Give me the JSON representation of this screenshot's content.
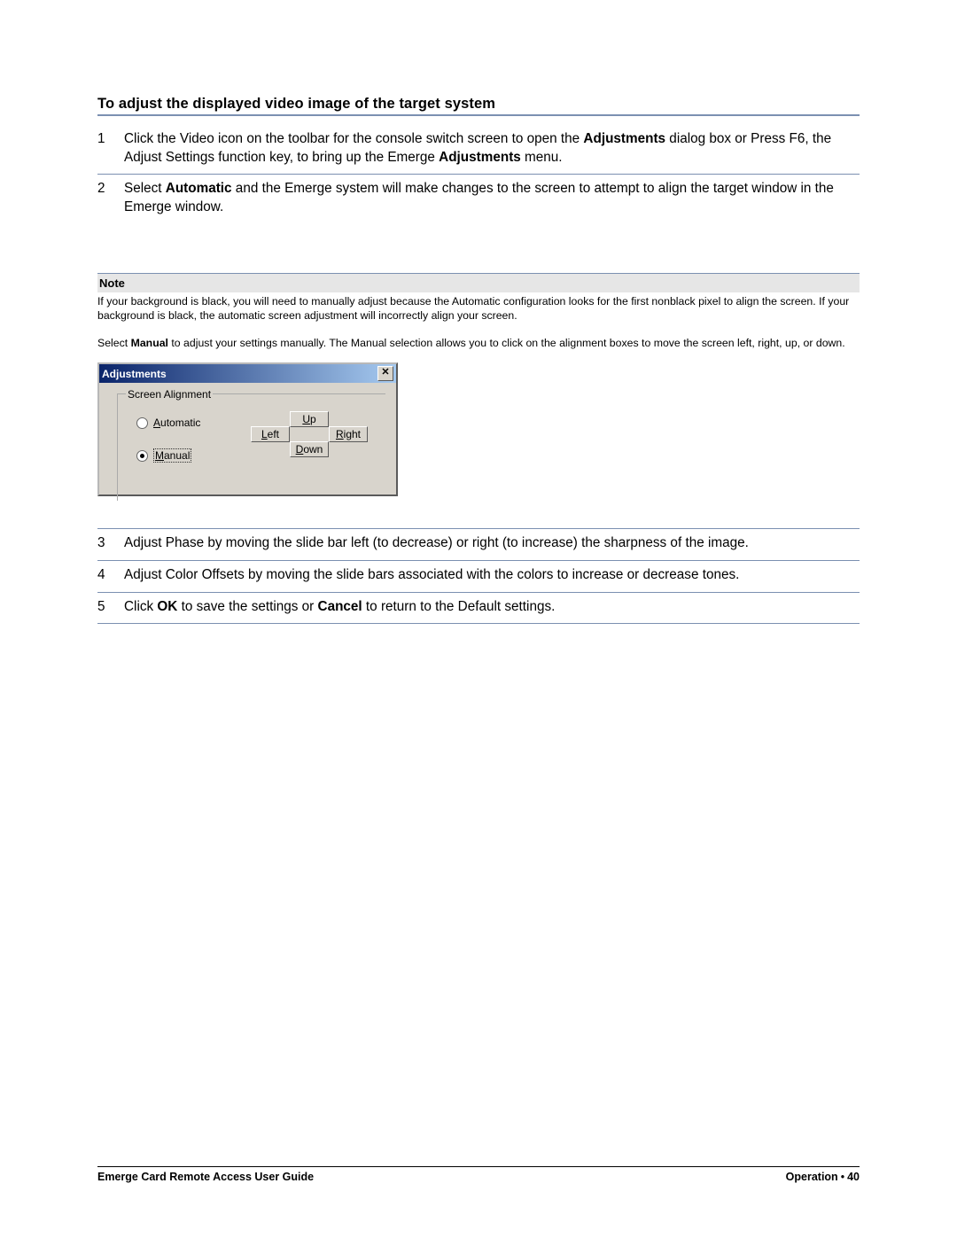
{
  "title": "To adjust the displayed video image of the target system",
  "steps_a": [
    {
      "n": "1",
      "html": "Click the Video icon on the toolbar for the console switch screen to open the <b>Adjustments</b> dialog box or Press F6, the Adjust Settings function key, to bring up the Emerge <b>Adjustments</b> menu."
    },
    {
      "n": "2",
      "html": "Select <b>Automatic</b> and the Emerge system will make changes to the screen to attempt to align the target window in the Emerge window."
    }
  ],
  "note": {
    "head": "Note",
    "p1": "If your background is black, you will need to manually adjust because the Automatic configuration looks for the first nonblack pixel to align the screen. If your background is black, the automatic screen adjustment will incorrectly align your screen.",
    "p2_html": "Select <b>Manual</b> to adjust your settings manually. The Manual selection allows you to click on the alignment boxes to move the screen left, right, up, or down."
  },
  "dialog": {
    "title": "Adjustments",
    "group": "Screen Alignment",
    "automatic_html": "<u>A</u>utomatic",
    "manual_html": "<u>M</u>anual",
    "up_html": "<u>U</u>p",
    "down_html": "<u>D</u>own",
    "left_html": "<u>L</u>eft",
    "right_html": "<u>R</u>ight"
  },
  "steps_b": [
    {
      "n": "3",
      "html": "Adjust Phase by moving the slide bar left (to decrease) or right (to increase) the sharpness of the image."
    },
    {
      "n": "4",
      "html": "Adjust Color Offsets by moving the slide bars associated with the colors to increase or decrease tones."
    },
    {
      "n": "5",
      "html": "Click <b>OK</b> to save the settings or <b>Cancel</b> to return to the Default settings."
    }
  ],
  "footer": {
    "left": "Emerge Card Remote Access User Guide",
    "section": "Operation",
    "page": "40"
  }
}
